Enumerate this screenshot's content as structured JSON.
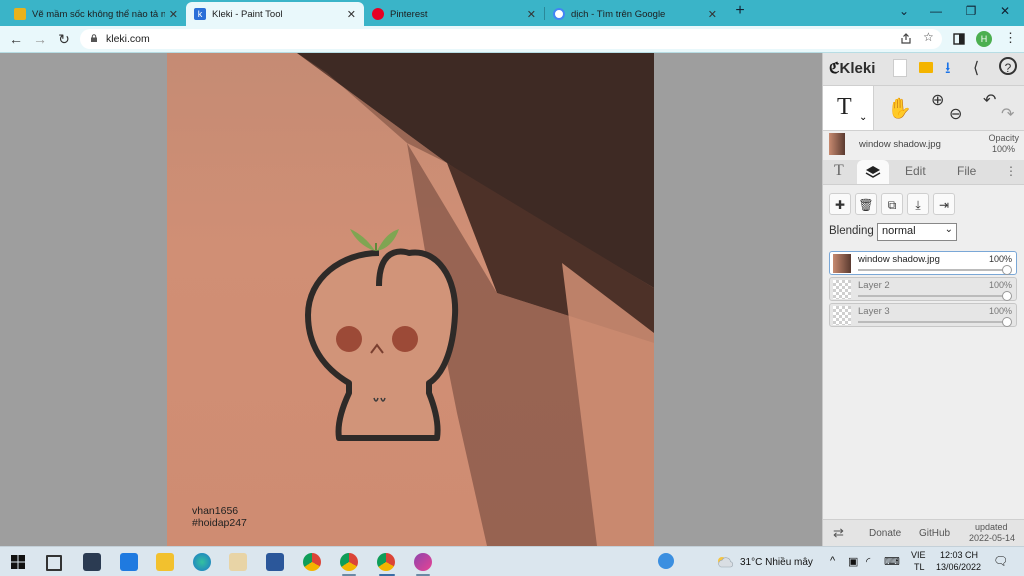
{
  "browser": {
    "tabs": [
      {
        "title": "Vẽ mầm sốc không thể nào tả nổi",
        "active": false,
        "icon": "yellow-file-icon"
      },
      {
        "title": "Kleki - Paint Tool",
        "active": true,
        "icon": "kleki-icon"
      },
      {
        "title": "Pinterest",
        "active": false,
        "icon": "pinterest-icon"
      },
      {
        "title": "dịch - Tìm trên Google",
        "active": false,
        "icon": "google-icon"
      }
    ],
    "new_tab_symbol": "+",
    "close_symbol": "✕",
    "url": "kleki.com",
    "profile_initial": "H",
    "window_controls": {
      "dropdown": "⌄",
      "minimize": "—",
      "restore": "❐",
      "close": "✕"
    }
  },
  "canvas": {
    "watermark_line1": "vhan1656",
    "watermark_line2": "#hoidap247"
  },
  "panel": {
    "app_name": "Kleki",
    "active_tool_letter": "T",
    "current_layer_name": "window shadow.jpg",
    "opacity_label": "Opacity",
    "opacity_value": "100%",
    "tabs": {
      "text": "T",
      "edit": "Edit",
      "file": "File",
      "more": "⋮"
    },
    "blending_label": "Blending",
    "blending_value": "normal",
    "layers": [
      {
        "name": "window shadow.jpg",
        "opacity": "100%",
        "selected": true
      },
      {
        "name": "Layer 2",
        "opacity": "100%",
        "selected": false
      },
      {
        "name": "Layer 3",
        "opacity": "100%",
        "selected": false
      }
    ],
    "footer": {
      "donate": "Donate",
      "github": "GitHub",
      "updated_label": "updated",
      "updated_date": "2022-05-14"
    }
  },
  "taskbar": {
    "weather": "31°C  Nhiều mây",
    "lang1": "VIE",
    "lang2": "TL",
    "time": "12:03 CH",
    "date": "13/06/2022"
  },
  "colors": {
    "tab_strip": "#3ab4c8",
    "image_peach": "#cf8c72",
    "panel_bg": "#eeeeee"
  }
}
